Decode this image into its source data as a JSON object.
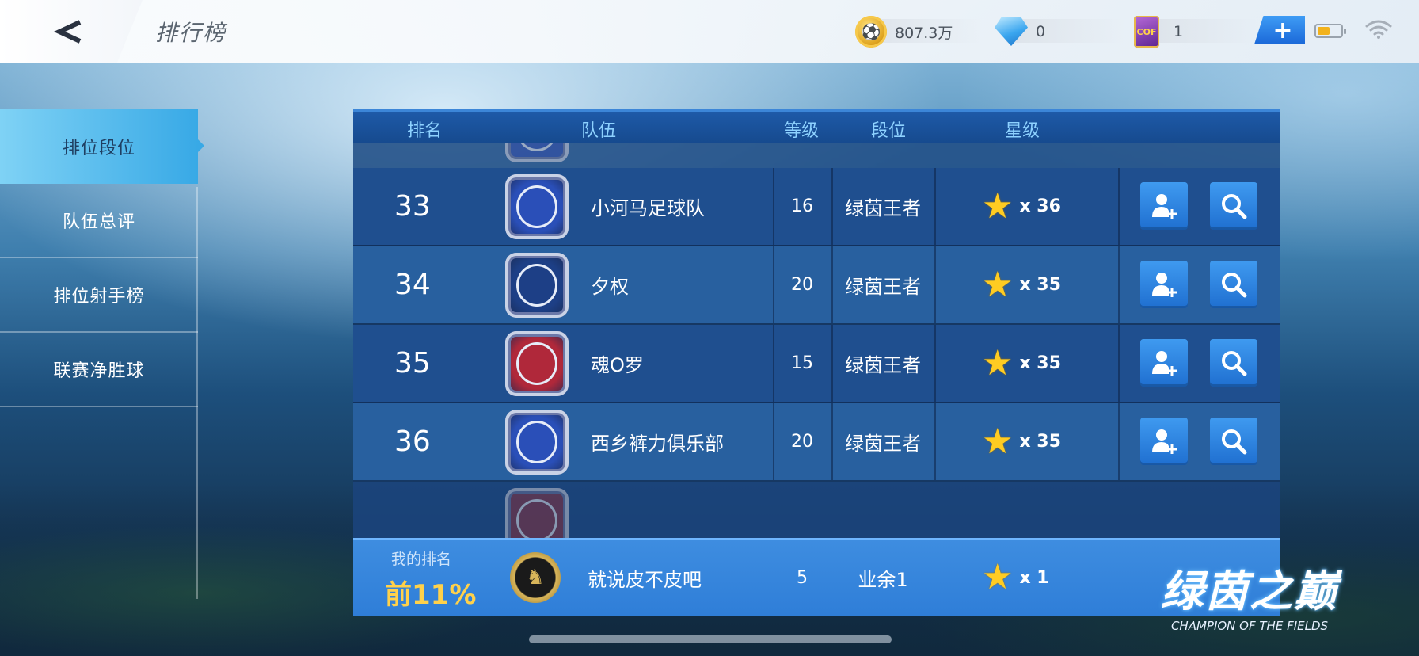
{
  "header": {
    "title": "排行榜",
    "coins": "807.3万",
    "diamonds": "0",
    "cards": "1",
    "card_icon_text": "COF",
    "plus_label": "+"
  },
  "sidebar": {
    "items": [
      {
        "label": "排位段位",
        "active": true
      },
      {
        "label": "队伍总评",
        "active": false
      },
      {
        "label": "排位射手榜",
        "active": false
      },
      {
        "label": "联赛净胜球",
        "active": false
      }
    ]
  },
  "table": {
    "columns": {
      "rank": "排名",
      "team": "队伍",
      "level": "等级",
      "tier": "段位",
      "stars": "星级"
    },
    "rows": [
      {
        "rank": "33",
        "team": "小河马足球队",
        "level": "16",
        "tier": "绿茵王者",
        "stars": "x 36",
        "badge_color": "#2a4fb8"
      },
      {
        "rank": "34",
        "team": "夕权",
        "level": "20",
        "tier": "绿茵王者",
        "stars": "x 35",
        "badge_color": "#1d3f86"
      },
      {
        "rank": "35",
        "team": "魂O罗",
        "level": "15",
        "tier": "绿茵王者",
        "stars": "x 35",
        "badge_color": "#b0283a"
      },
      {
        "rank": "36",
        "team": "西乡裤力俱乐部",
        "level": "20",
        "tier": "绿茵王者",
        "stars": "x 35",
        "badge_color": "#2a4fb8"
      }
    ],
    "scroll_hint": "︾"
  },
  "my_rank": {
    "label": "我的排名",
    "percentile": "前11%",
    "team": "就说皮不皮吧",
    "level": "5",
    "tier": "业余1",
    "stars": "x 1"
  },
  "logo": {
    "cn": "绿茵之巅",
    "en": "CHAMPION OF THE FIELDS"
  },
  "colors": {
    "accent": "#2f7ed8",
    "star": "#ffcc22",
    "percent": "#ffd14a",
    "header_text": "#8ed2ff"
  },
  "icons": {
    "back": "back-arrow-icon",
    "add_friend": "add-friend-icon",
    "search": "search-icon",
    "coin": "coin-icon",
    "diamond": "diamond-icon",
    "battery": "battery-icon",
    "wifi": "wifi-icon"
  },
  "battery_level": 0.55
}
